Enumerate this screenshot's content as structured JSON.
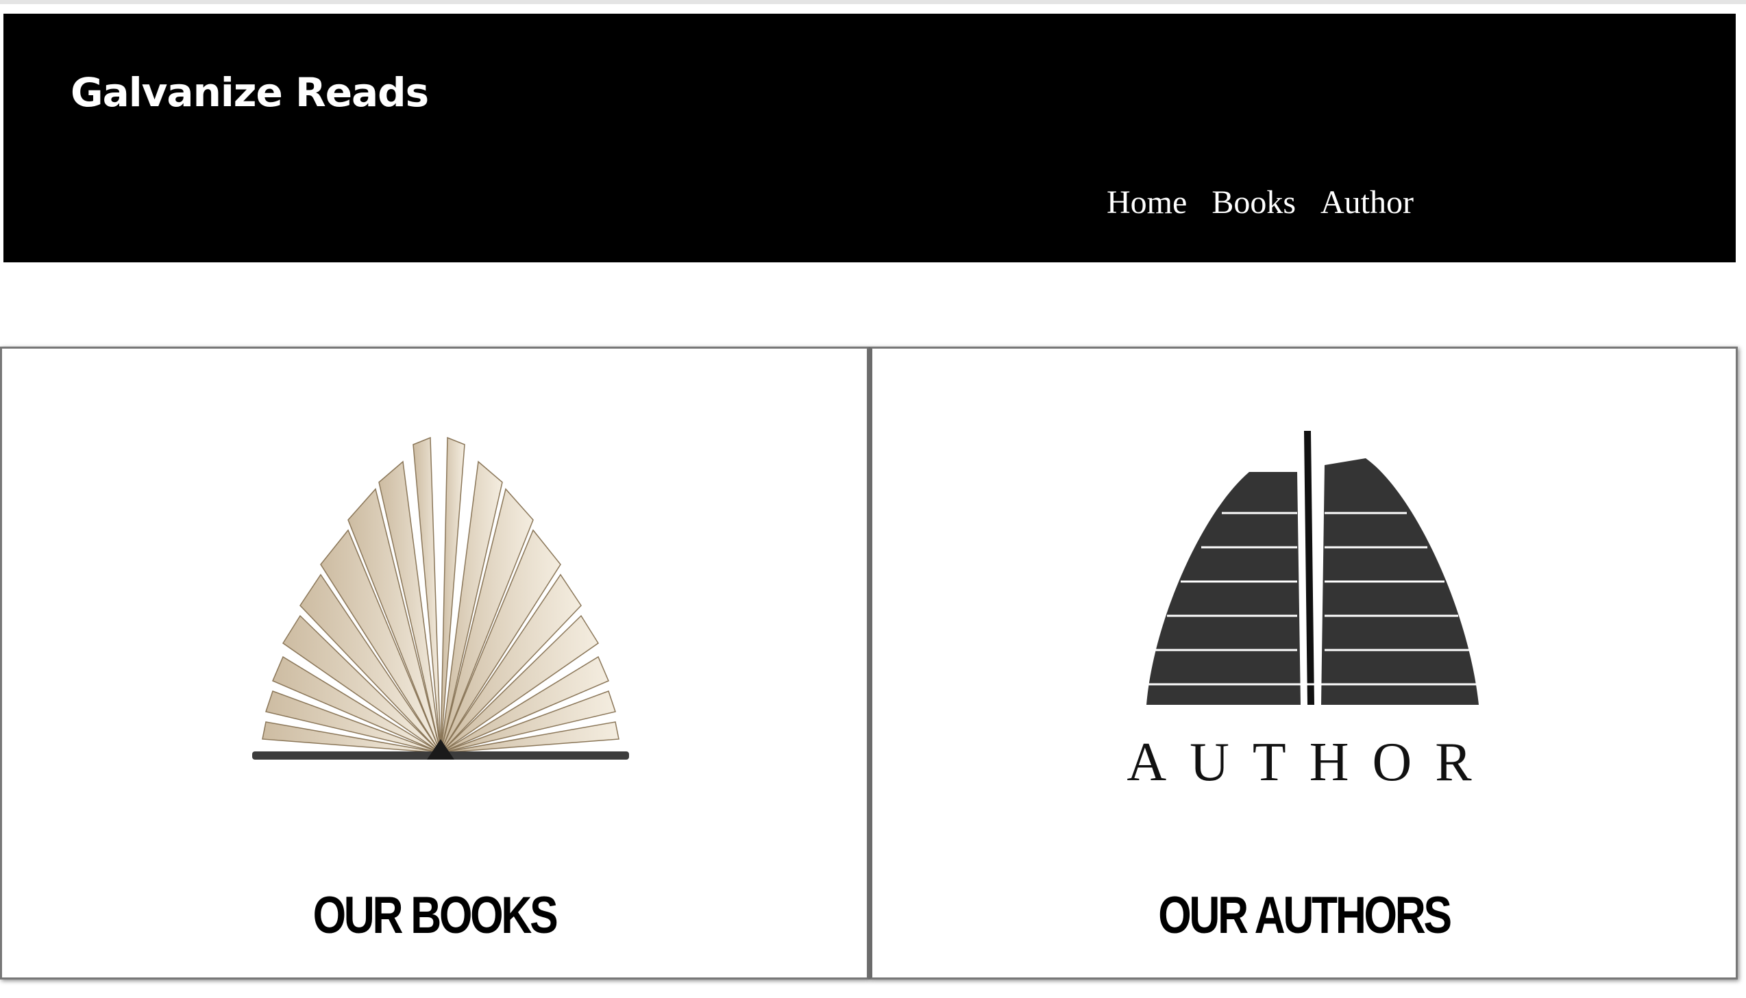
{
  "header": {
    "brand": "Galvanize Reads",
    "nav": [
      {
        "label": "Home"
      },
      {
        "label": "Books"
      },
      {
        "label": "Author"
      }
    ]
  },
  "cards": [
    {
      "title": "OUR BOOKS",
      "image_icon": "open-book-icon"
    },
    {
      "title": "OUR AUTHORS",
      "image_icon": "author-word-cloud-book-icon",
      "image_text": "AUTHOR"
    }
  ],
  "colors": {
    "navbar_bg": "#000000",
    "navbar_text": "#ffffff",
    "page_bg": "#ffffff",
    "page_border": "#777777"
  }
}
